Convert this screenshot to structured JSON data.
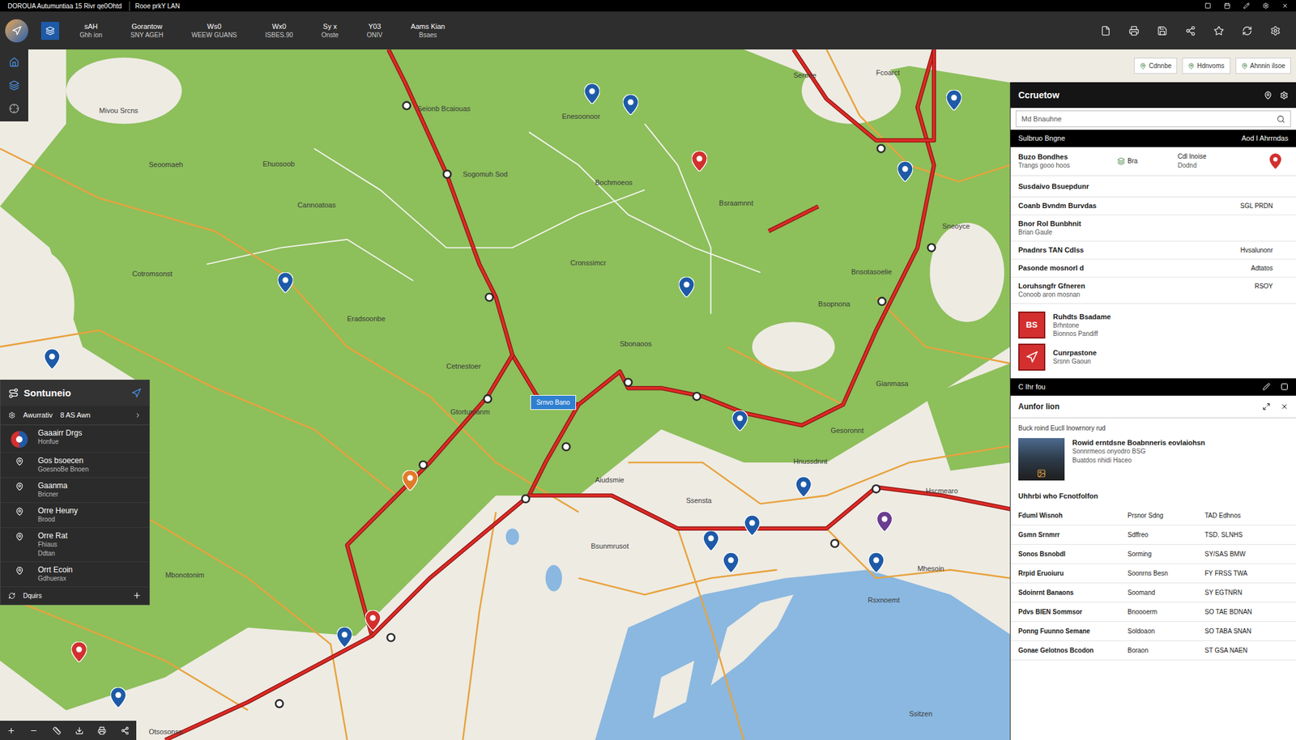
{
  "window": {
    "title": "DOROUA Autumuntiaa 15 Rivr qe0Ohtd",
    "subtitle": "Rooe prkY LAN"
  },
  "toolbar": {
    "items": [
      {
        "label": "sAH",
        "sub": "Ghh ion"
      },
      {
        "label": "Gorantow",
        "sub": "SNY AGEH"
      },
      {
        "label": "Ws0",
        "sub": "WEEW GUANS"
      },
      {
        "label": "Wx0",
        "sub": "ISBES.90"
      },
      {
        "label": "Sy x",
        "sub": "Onste"
      },
      {
        "label": "Y03",
        "sub": "ONIV"
      },
      {
        "label": "Aams Kian",
        "sub": "Bsaes"
      }
    ]
  },
  "layer_chips": [
    {
      "label": "Cdnnbe"
    },
    {
      "label": "Hdnvoms"
    },
    {
      "label": "Ahnnin ilsoe"
    }
  ],
  "map": {
    "callout": "Srnvo Bano",
    "labels": [
      "Seionb Bcaiouas",
      "Mivou Srcns",
      "Seoomaeh",
      "Ehuosoob",
      "Enesoonoor",
      "Sogomuh Sod",
      "Bochmoeos",
      "Bsraamnnt",
      "Cannoatoas",
      "Cronssimcr",
      "Cotromsonst",
      "Bnsotasoelie",
      "Eradsoonbe",
      "Bsopnona",
      "Sbonaoos",
      "Cetnestoer",
      "Gianmasa",
      "Gtortumanm",
      "Gesoronnt",
      "Aiudsmie",
      "Hnussdnnt",
      "Hscmearo",
      "Bsunmrusot",
      "Ssensta",
      "Mbonotonim",
      "Mhesoin",
      "Rsxnoemt",
      "Otsosonsa",
      "Ssitzen",
      "Fcoarct",
      "Seroee",
      "Sneoyce"
    ],
    "pins": [
      {
        "color": "#1e5aa8"
      },
      {
        "color": "#d32f2f"
      },
      {
        "color": "#1e5aa8"
      },
      {
        "color": "#1e5aa8"
      },
      {
        "color": "#1e5aa8"
      },
      {
        "color": "#1e5aa8"
      },
      {
        "color": "#1e5aa8"
      },
      {
        "color": "#1e5aa8"
      },
      {
        "color": "#1e5aa8"
      },
      {
        "color": "#1e5aa8"
      },
      {
        "color": "#1e5aa8"
      },
      {
        "color": "#1e5aa8"
      },
      {
        "color": "#1e5aa8"
      },
      {
        "color": "#6a3d8f"
      },
      {
        "color": "#1e5aa8"
      },
      {
        "color": "#1e5aa8"
      },
      {
        "color": "#d32f2f"
      },
      {
        "color": "#d32f2f"
      },
      {
        "color": "#e07b2a"
      },
      {
        "color": "#1e5aa8"
      }
    ]
  },
  "left_panel": {
    "title": "Sontuneio",
    "filter": {
      "label": "Awurrativ",
      "value": "8 AS Awn"
    },
    "items": [
      {
        "title": "Gaaairr Drgs",
        "lines": [
          "Honfue"
        ]
      },
      {
        "title": "Gos bsoecen",
        "lines": [
          "GoesnoBe Bnoen"
        ]
      },
      {
        "title": "Gaanma",
        "lines": [
          "Bricner"
        ]
      },
      {
        "title": "Orre Heuny",
        "lines": [
          "Brood"
        ]
      },
      {
        "title": "Orre Rat",
        "lines": [
          "Fhiaus",
          "Ddtan"
        ]
      },
      {
        "title": "Orrt Ecoin",
        "lines": [
          "Gdhuerax"
        ]
      }
    ],
    "footer": "Dquirs"
  },
  "right_panel": {
    "title": "Ccruetow",
    "search": {
      "placeholder": "Md Bnauhne"
    },
    "bar": {
      "left": "Sulbruo Bngne",
      "right": "Aod I Ahrrndas"
    },
    "summary": {
      "name": "Buzo Bondhes",
      "sub": "Trangs gooo hoos",
      "tag": "Bra",
      "status": "Cdl Inoise",
      "status_sub": "Dodnd"
    },
    "heading": "Susdaivo Bsuepdunr",
    "rows": [
      {
        "label": "Coanb Bvndm Burvdas",
        "value": "SGL PRDN",
        "sub": ""
      },
      {
        "label": "Bnor Rol Bunbhnit",
        "value": "",
        "sub": "Brian Gaule"
      },
      {
        "label": "Pnadnrs TAN Cdlss",
        "value": "Hvsalunonr",
        "sub": ""
      },
      {
        "label": "Pasonde mosnorl d",
        "value": "Adtatos",
        "sub": ""
      },
      {
        "label": "Loruhsngfr Gfneren",
        "value": "RSOY",
        "sub": "Conoob aron mosnan"
      }
    ],
    "features": [
      {
        "title": "Ruhdts Bsadame",
        "badge": "BS",
        "lines": [
          "Brhntone",
          "Bionnos Pandiff"
        ]
      },
      {
        "title": "Cunrpastone",
        "badge": "",
        "lines": [
          "Srsnn Gaoun"
        ]
      }
    ],
    "bar2": "C Ihr fou",
    "section": {
      "title": "Aunfor lion",
      "intro": "Buck roind Eucll Inowrnory rud",
      "card": {
        "title": "Rowid erntdsne Boabnneris eovlaiohsn",
        "lines": [
          "Sonnrmeos onyodro BSG",
          "Buatdos nhidi Haceo"
        ]
      }
    },
    "table": {
      "title": "Uhhrbi who Fcnotfolfon",
      "rows": [
        [
          "Fduml Wisnoh",
          "Prsnor Sdng",
          "TAD Edhnos"
        ],
        [
          "Gsmn Srnmrr",
          "Sdffreo",
          "TSD. SLNHS"
        ],
        [
          "Sonos Bsnobdl",
          "Sorming",
          "SY/SAS BMW"
        ],
        [
          "Rrpid Eruoiuru",
          "Soonrns Besn",
          "FY FRSS TWA"
        ],
        [
          "Sdoinrnt Banaons",
          "Soomand",
          "SY EGTNRN"
        ],
        [
          "Pdvs BIEN Sommsor",
          "Bnoooerm",
          "SO TAE BDNAN"
        ],
        [
          "Ponng Fuunno Semane",
          "Soldoaon",
          "SO TABA SNAN"
        ],
        [
          "Gonae Gelotnos Bcodon",
          "Boraon",
          "ST GSA NAEN"
        ]
      ]
    }
  }
}
